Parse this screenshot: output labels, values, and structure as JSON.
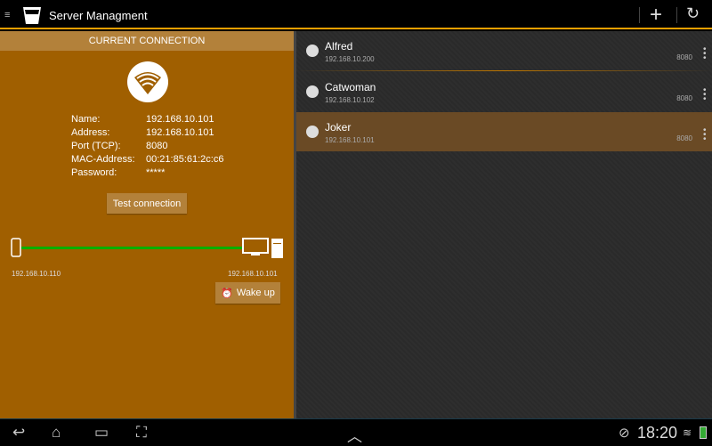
{
  "app": {
    "title": "Server Managment"
  },
  "current": {
    "header": "CURRENT CONNECTION",
    "fields": [
      {
        "label": "Name:",
        "value": "192.168.10.101"
      },
      {
        "label": "Address:",
        "value": "192.168.10.101"
      },
      {
        "label": "Port (TCP):",
        "value": "8080"
      },
      {
        "label": "MAC-Address:",
        "value": "00:21:85:61:2c:c6"
      },
      {
        "label": "Password:",
        "value": "*****"
      }
    ],
    "test_label": "Test connection",
    "client_ip": "192.168.10.110",
    "server_ip": "192.168.10.101",
    "wake_label": "Wake up",
    "link_color": "#00b000"
  },
  "servers": [
    {
      "name": "Alfred",
      "ip": "192.168.10.200",
      "port": "8080"
    },
    {
      "name": "Catwoman",
      "ip": "192.168.10.102",
      "port": "8080"
    },
    {
      "name": "Joker",
      "ip": "192.168.10.101",
      "port": "8080"
    }
  ],
  "status": {
    "time": "18:20"
  }
}
